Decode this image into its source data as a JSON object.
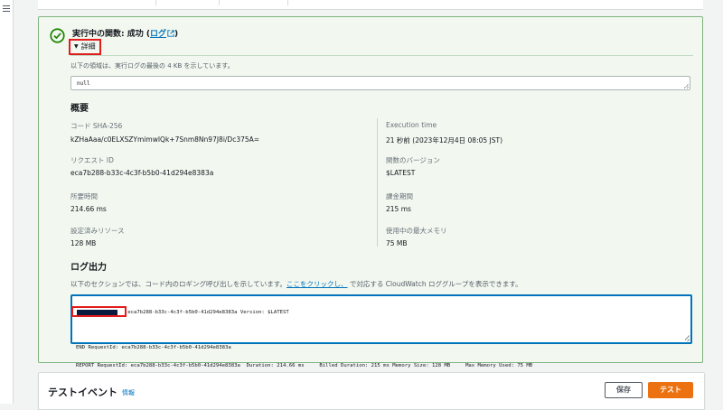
{
  "status": {
    "prefix": "実行中の関数: 成功",
    "open_paren": " (",
    "log_link": "ログ",
    "close_paren": ")",
    "success_color": "#1d8102"
  },
  "details": {
    "toggle_label": "詳細",
    "region_note": "以下の領域は、実行ログの最後の 4 KB を示しています。",
    "payload": "null"
  },
  "summary": {
    "title": "概要",
    "left": [
      {
        "label": "コード SHA-256",
        "value": "kZHaAaa/c0ELXSZYmimwIQk+7Snm8Nn97J8i/Dc375A="
      },
      {
        "label": "リクエスト ID",
        "value": "eca7b288-b33c-4c3f-b5b0-41d294e8383a"
      },
      {
        "label": "所要時間",
        "value": "214.66 ms"
      },
      {
        "label": "設定済みリソース",
        "value": "128 MB"
      }
    ],
    "right": [
      {
        "label": "Execution time",
        "value": "21 秒前 (2023年12月4日 08:05 JST)"
      },
      {
        "label": "関数のバージョン",
        "value": "$LATEST"
      },
      {
        "label": "課金期間",
        "value": "215 ms"
      },
      {
        "label": "使用中の最大メモリ",
        "value": "75 MB"
      }
    ]
  },
  "log_output": {
    "title": "ログ出力",
    "desc_before": "以下のセクションでは、コード内のロギング呼び出しを示しています。",
    "desc_link": "ここをクリックし、",
    "desc_after": "で対応する CloudWatch ロググループを表示できます。",
    "lines": [
      "START RequestId: eca7b288-b33c-4c3f-b5b0-41d294e8383a Version: $LATEST",
      "",
      "END RequestId: eca7b288-b33c-4c3f-b5b0-41d294e8383a",
      "REPORT RequestId: eca7b288-b33c-4c3f-b5b0-41d294e8383a  Duration: 214.66 ms     Billed Duration: 215 ms Memory Size: 128 MB     Max Memory Used: 75 MB"
    ]
  },
  "test_event": {
    "title": "テストイベント",
    "info_link": "情報",
    "save_label": "保存",
    "test_label": "テスト",
    "accent_color": "#ec7211"
  },
  "icons": [
    "hamburger-icon",
    "success-check-icon",
    "external-link-icon",
    "caret-down-icon",
    "resize-grip-icon"
  ]
}
